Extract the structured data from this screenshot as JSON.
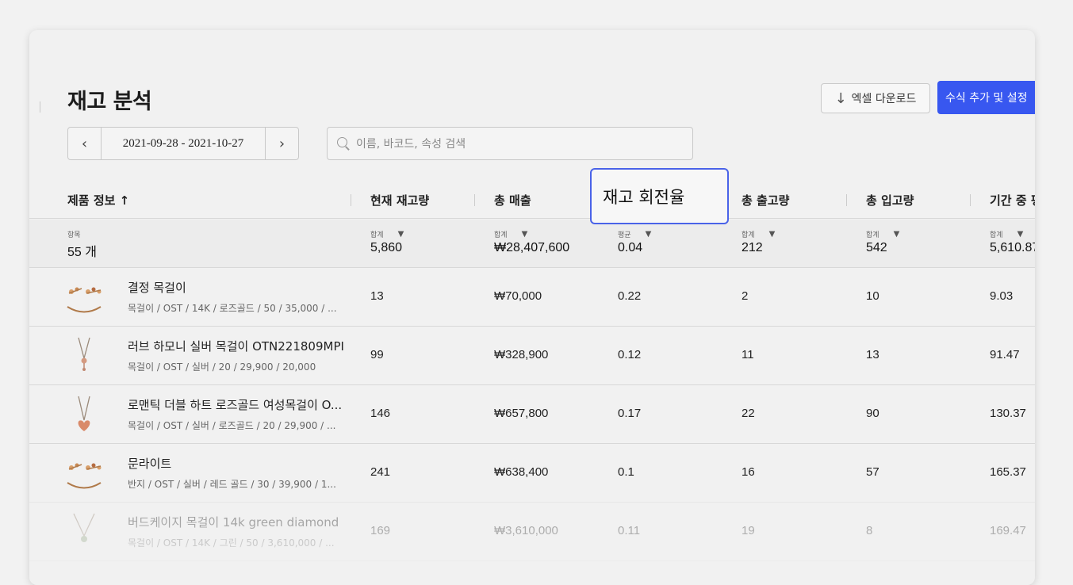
{
  "page": {
    "title": "재고 분석",
    "excel_button": "엑셀 다운로드",
    "formula_button": "수식 추가 및 설정",
    "date_range": "2021-09-28 - 2021-10-27",
    "search_placeholder": "이름, 바코드, 속성 검색"
  },
  "headers": {
    "product_info": "제품 정보 ↑",
    "current_stock": "현재 재고량",
    "total_sales": "총 매출",
    "turnover": "재고 회전율",
    "total_outbound": "총 출고량",
    "total_inbound": "총 입고량",
    "period_avg": "기간 중 평"
  },
  "summary": {
    "items_label": "항목",
    "items_value": "55 개",
    "sum_label": "합계",
    "avg_label": "평균",
    "current_stock": "5,860",
    "total_sales": "₩28,407,600",
    "turnover": "0.04",
    "total_outbound": "212",
    "total_inbound": "542",
    "period_avg": "5,610.87"
  },
  "rows": [
    {
      "name": "결정 목걸이",
      "attrs": "목걸이 / OST / 14K / 로즈골드 / 50 / 35,000 / ...",
      "stock": "13",
      "sales": "₩70,000",
      "turnover": "0.22",
      "out": "2",
      "in": "10",
      "avg": "9.03",
      "icon": "bracelet-icon"
    },
    {
      "name": "러브 하모니 실버 목걸이 OTN221809MPI",
      "attrs": "목걸이 / OST / 실버 / 20 / 29,900 / 20,000",
      "stock": "99",
      "sales": "₩328,900",
      "turnover": "0.12",
      "out": "11",
      "in": "13",
      "avg": "91.47",
      "icon": "necklace-icon"
    },
    {
      "name": "로맨틱 더블 하트 로즈골드 여성목걸이 O...",
      "attrs": "목걸이 / OST / 실버 / 로즈골드 / 20 / 29,900 / ...",
      "stock": "146",
      "sales": "₩657,800",
      "turnover": "0.17",
      "out": "22",
      "in": "90",
      "avg": "130.37",
      "icon": "heart-necklace-icon"
    },
    {
      "name": "문라이트",
      "attrs": "반지 / OST / 실버 / 레드 골드 / 30 / 39,900 / 1...",
      "stock": "241",
      "sales": "₩638,400",
      "turnover": "0.1",
      "out": "16",
      "in": "57",
      "avg": "165.37",
      "icon": "bracelet-icon"
    },
    {
      "name": "버드케이지 목걸이 14k green diamond",
      "attrs": "목걸이 / OST / 14K / 그린 / 50 / 3,610,000 / ...",
      "stock": "169",
      "sales": "₩3,610,000",
      "turnover": "0.11",
      "out": "19",
      "in": "8",
      "avg": "169.47",
      "icon": "necklace-icon"
    }
  ]
}
